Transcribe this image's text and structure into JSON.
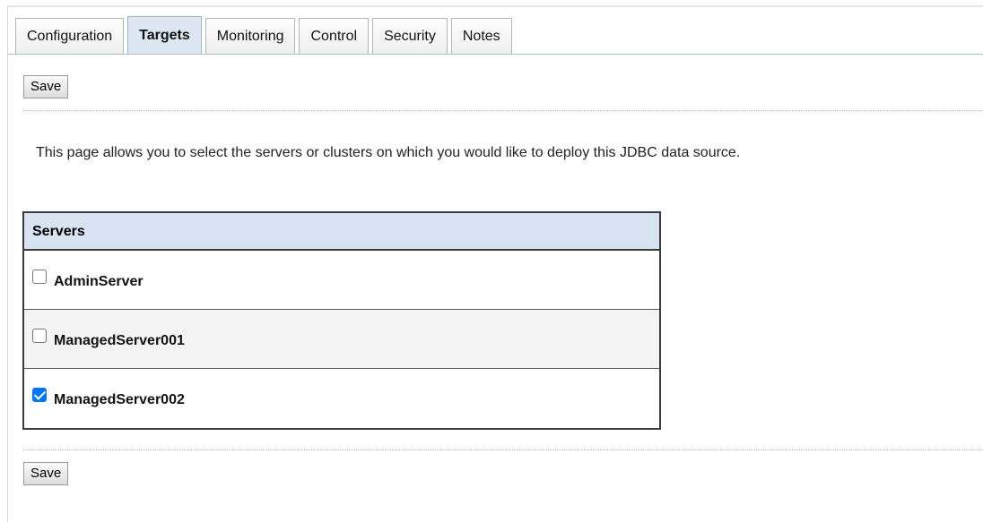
{
  "tabs": [
    {
      "label": "Configuration",
      "active": false
    },
    {
      "label": "Targets",
      "active": true
    },
    {
      "label": "Monitoring",
      "active": false
    },
    {
      "label": "Control",
      "active": false
    },
    {
      "label": "Security",
      "active": false
    },
    {
      "label": "Notes",
      "active": false
    }
  ],
  "actions": {
    "save_label_top": "Save",
    "save_label_bottom": "Save"
  },
  "intro_text": "This page allows you to select the servers or clusters on which you would like to deploy this JDBC data source.",
  "servers_table": {
    "header": "Servers",
    "rows": [
      {
        "name": "AdminServer",
        "checked": false
      },
      {
        "name": "ManagedServer001",
        "checked": false
      },
      {
        "name": "ManagedServer002",
        "checked": true
      }
    ]
  },
  "colors": {
    "active_tab_bg": "#dce7f3",
    "table_header_bg": "#d7e3f1",
    "checkbox_checked": "#0075ff"
  }
}
